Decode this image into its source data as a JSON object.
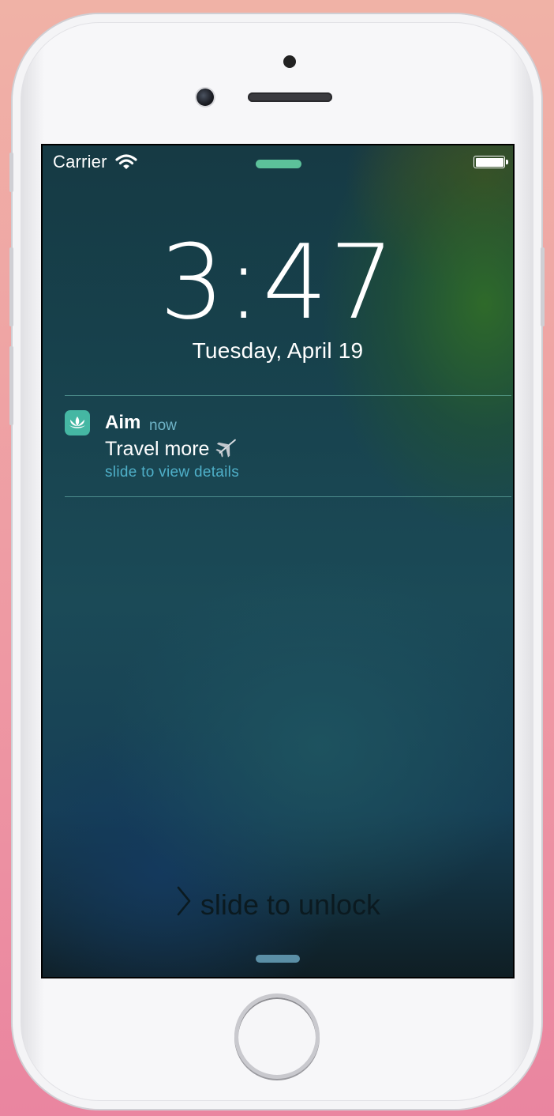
{
  "status_bar": {
    "carrier": "Carrier",
    "wifi_icon": "wifi-icon",
    "battery_icon": "battery-icon",
    "battery_level": 1.0
  },
  "lock_screen": {
    "time": "3:47",
    "date": "Tuesday, April 19"
  },
  "notification": {
    "app_icon": "lotus-icon",
    "app_name": "Aim",
    "time": "now",
    "message": "Travel more",
    "message_icon": "airplane-icon",
    "hint": "slide to view details"
  },
  "unlock": {
    "icon": "chevron-right-icon",
    "label": "slide to unlock"
  },
  "colors": {
    "accent_green": "#5cc19a",
    "app_icon_bg": "#45b7a3",
    "hint_text": "#4fb0c9",
    "bottom_grabber": "#5b8fa6"
  }
}
